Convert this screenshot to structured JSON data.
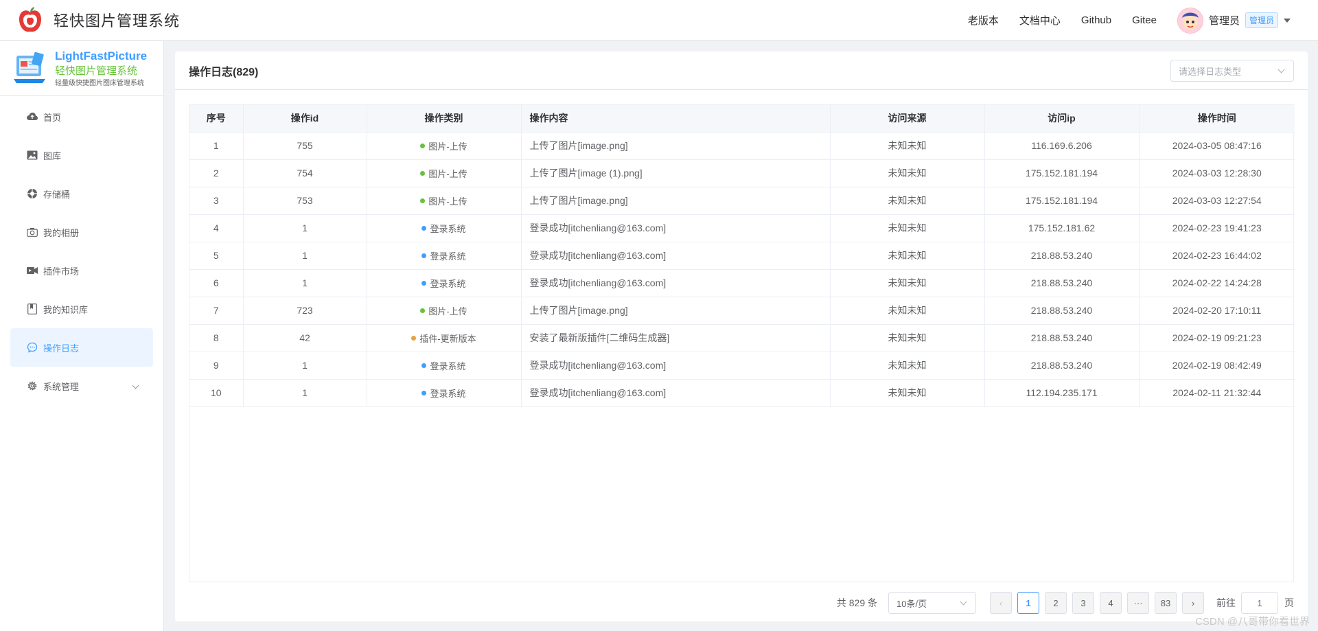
{
  "header": {
    "app_title": "轻快图片管理系统",
    "nav": [
      "老版本",
      "文档中心",
      "Github",
      "Gitee"
    ],
    "user_name": "管理员",
    "role": "管理员"
  },
  "brand": {
    "name_en": "LightFastPicture",
    "name_cn": "轻快图片管理系统",
    "subtitle": "轻量级快捷图片图床管理系统"
  },
  "sidebar": {
    "items": [
      {
        "label": "首页",
        "icon": "cloud-icon"
      },
      {
        "label": "图库",
        "icon": "image-icon"
      },
      {
        "label": "存储桶",
        "icon": "bucket-icon"
      },
      {
        "label": "我的相册",
        "icon": "camera-icon"
      },
      {
        "label": "插件市场",
        "icon": "plugin-icon"
      },
      {
        "label": "我的知识库",
        "icon": "book-icon"
      },
      {
        "label": "操作日志",
        "icon": "chat-icon",
        "active": true
      },
      {
        "label": "系统管理",
        "icon": "gear-icon"
      }
    ]
  },
  "panel": {
    "title": "操作日志(829)",
    "type_select_placeholder": "请选择日志类型"
  },
  "table": {
    "headers": [
      "序号",
      "操作id",
      "操作类别",
      "操作内容",
      "访问来源",
      "访问ip",
      "操作时间"
    ],
    "rows": [
      [
        "1",
        "755",
        "图片-上传",
        "上传了图片[image.png]",
        "未知未知",
        "116.169.6.206",
        "2024-03-05 08:47:16"
      ],
      [
        "2",
        "754",
        "图片-上传",
        "上传了图片[image (1).png]",
        "未知未知",
        "175.152.181.194",
        "2024-03-03 12:28:30"
      ],
      [
        "3",
        "753",
        "图片-上传",
        "上传了图片[image.png]",
        "未知未知",
        "175.152.181.194",
        "2024-03-03 12:27:54"
      ],
      [
        "4",
        "1",
        "登录系统",
        "登录成功[itchenliang@163.com]",
        "未知未知",
        "175.152.181.62",
        "2024-02-23 19:41:23"
      ],
      [
        "5",
        "1",
        "登录系统",
        "登录成功[itchenliang@163.com]",
        "未知未知",
        "218.88.53.240",
        "2024-02-23 16:44:02"
      ],
      [
        "6",
        "1",
        "登录系统",
        "登录成功[itchenliang@163.com]",
        "未知未知",
        "218.88.53.240",
        "2024-02-22 14:24:28"
      ],
      [
        "7",
        "723",
        "图片-上传",
        "上传了图片[image.png]",
        "未知未知",
        "218.88.53.240",
        "2024-02-20 17:10:11"
      ],
      [
        "8",
        "42",
        "插件-更新版本",
        "安装了最新版插件[二维码生成器]",
        "未知未知",
        "218.88.53.240",
        "2024-02-19 09:21:23"
      ],
      [
        "9",
        "1",
        "登录系统",
        "登录成功[itchenliang@163.com]",
        "未知未知",
        "218.88.53.240",
        "2024-02-19 08:42:49"
      ],
      [
        "10",
        "1",
        "登录系统",
        "登录成功[itchenliang@163.com]",
        "未知未知",
        "112.194.235.171",
        "2024-02-11 21:32:44"
      ]
    ],
    "category_colors": {
      "图片-上传": "#67c23a",
      "登录系统": "#409eff",
      "插件-更新版本": "#e6a23c"
    }
  },
  "pagination": {
    "total_text": "共 829 条",
    "page_size": "10条/页",
    "pages": [
      "1",
      "2",
      "3",
      "4",
      "···",
      "83"
    ],
    "current_page": "1",
    "prev": "‹",
    "next": "›",
    "goto_prefix": "前往",
    "goto_value": "1",
    "goto_suffix": "页"
  },
  "watermark": "CSDN @八哥带你看世界"
}
